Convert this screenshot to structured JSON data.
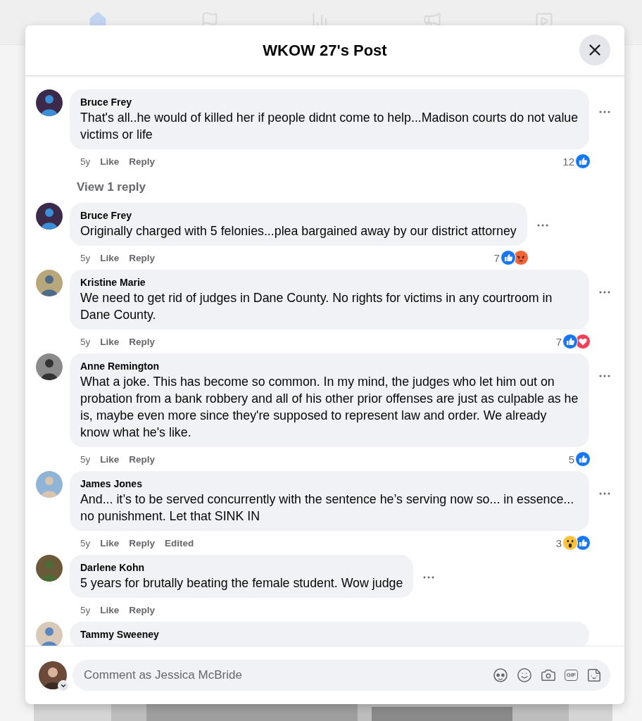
{
  "background_nav": {
    "items": [
      {
        "kind": "home",
        "selected": true
      },
      {
        "kind": "flag",
        "selected": false
      },
      {
        "kind": "chart",
        "selected": false
      },
      {
        "kind": "megaphone",
        "selected": false
      },
      {
        "kind": "video",
        "selected": false
      }
    ]
  },
  "dialog": {
    "title": "WKOW 27's Post"
  },
  "comments": [
    {
      "author": "Bruce Frey",
      "text": "That's all..he would of killed her if people didnt come to help...Madison courts do not value victims or life",
      "time": "5y",
      "like": "Like",
      "reply": "Reply",
      "reactions": {
        "count": "12",
        "icons": [
          {
            "kind": "like"
          }
        ]
      },
      "view_replies": "View 1 reply"
    },
    {
      "author": "Bruce Frey",
      "text": "Originally charged with 5 felonies...plea bargained away by our district attorney",
      "time": "5y",
      "like": "Like",
      "reply": "Reply",
      "reactions": {
        "count": "7",
        "icons": [
          {
            "kind": "like"
          },
          {
            "kind": "angry"
          }
        ]
      }
    },
    {
      "author": "Kristine Marie",
      "text": "We need to get rid of judges in Dane County. No rights for victims in any courtroom in Dane County.",
      "time": "5y",
      "like": "Like",
      "reply": "Reply",
      "reactions": {
        "count": "7",
        "icons": [
          {
            "kind": "like"
          },
          {
            "kind": "love"
          }
        ]
      }
    },
    {
      "author": "Anne Remington",
      "text": "What a joke. This has become so common. In my mind, the judges who let him out on probation from a bank robbery and all of his other prior offenses are just as culpable as he is, maybe even more since they're supposed to represent law and order. We already know what he's like.",
      "time": "5y",
      "like": "Like",
      "reply": "Reply",
      "reactions": {
        "count": "5",
        "icons": [
          {
            "kind": "like"
          }
        ]
      }
    },
    {
      "author": "James Jones",
      "text": "And... it’s to be served concurrently with the sentence he’s serving now so... in essence... no punishment. Let that SINK IN",
      "time": "5y",
      "like": "Like",
      "reply": "Reply",
      "edited": "Edited",
      "reactions": {
        "count": "3",
        "icons": [
          {
            "kind": "wow"
          },
          {
            "kind": "like"
          }
        ]
      }
    },
    {
      "author": "Darlene Kohn",
      "text": "5 years for brutally beating the female student. Wow judge",
      "time": "5y",
      "like": "Like",
      "reply": "Reply"
    },
    {
      "author": "Tammy Sweeney"
    }
  ],
  "composer": {
    "placeholder": "Comment as Jessica McBride",
    "tools": [
      {
        "kind": "avatar"
      },
      {
        "kind": "emoji"
      },
      {
        "kind": "camera"
      },
      {
        "kind": "gif",
        "label": "GIF"
      },
      {
        "kind": "sticker"
      }
    ]
  }
}
